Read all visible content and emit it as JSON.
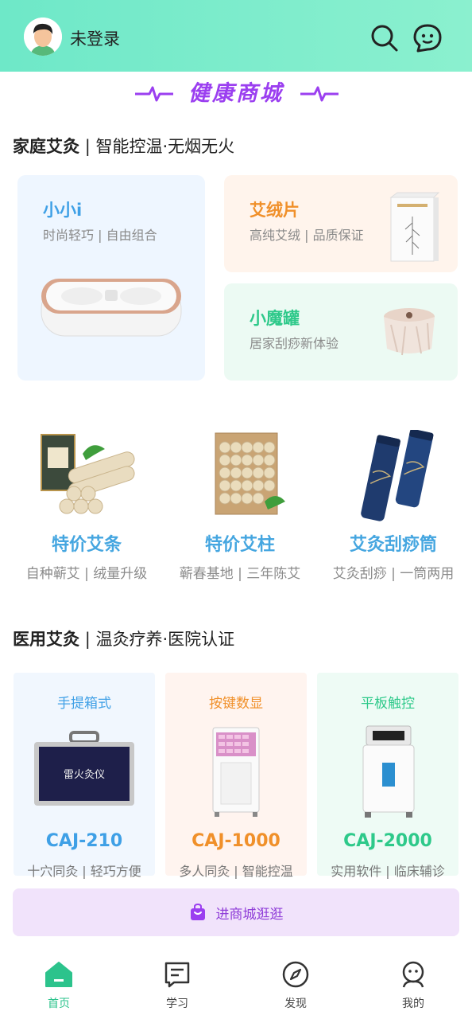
{
  "header": {
    "username": "未登录"
  },
  "banner": {
    "title": "健康商城"
  },
  "home_section": {
    "title": "家庭艾灸",
    "subtitle": "| 智能控温·无烟无火"
  },
  "home_cards": [
    {
      "name": "小小i",
      "desc": "时尚轻巧 | 自由组合",
      "color": "#3fa0e6"
    },
    {
      "name": "艾绒片",
      "desc": "高纯艾绒 | 品质保证",
      "color": "#f0902a"
    },
    {
      "name": "小魔罐",
      "desc": "居家刮痧新体验",
      "color": "#2ec98a"
    }
  ],
  "products": [
    {
      "name": "特价艾条",
      "desc": "自种蕲艾 | 绒量升级"
    },
    {
      "name": "特价艾柱",
      "desc": "蕲春基地 | 三年陈艾"
    },
    {
      "name": "艾灸刮痧筒",
      "desc": "艾灸刮痧 | 一筒两用"
    }
  ],
  "medical_section": {
    "title": "医用艾灸",
    "subtitle": "| 温灸疗养·医院认证"
  },
  "medical_cards": [
    {
      "title": "手提箱式",
      "model": "CAJ-210",
      "desc": "十穴同灸 | 轻巧方便",
      "color": "#3fa0e6",
      "bg": "#f1f7fe",
      "box_text": "雷火灸仪"
    },
    {
      "title": "按键数显",
      "model": "CAJ-1000",
      "desc": "多人同灸 | 智能控温",
      "color": "#f0902a",
      "bg": "#fff4ef"
    },
    {
      "title": "平板触控",
      "model": "CAJ-2000",
      "desc": "实用软件 | 临床辅诊",
      "color": "#2ec98a",
      "bg": "#eefbf5"
    }
  ],
  "shop_button": {
    "label": "进商城逛逛"
  },
  "tabs": [
    {
      "label": "首页",
      "icon": "home-icon",
      "active": true
    },
    {
      "label": "学习",
      "icon": "study-icon",
      "active": false
    },
    {
      "label": "发现",
      "icon": "compass-icon",
      "active": false
    },
    {
      "label": "我的",
      "icon": "profile-icon",
      "active": false
    }
  ],
  "colors": {
    "header_bg": "#7eedcc",
    "accent_purple": "#9b3ff0",
    "active_tab": "#2cc38c",
    "blue": "#3fa0e6",
    "orange": "#f0902a",
    "green": "#2ec98a"
  }
}
